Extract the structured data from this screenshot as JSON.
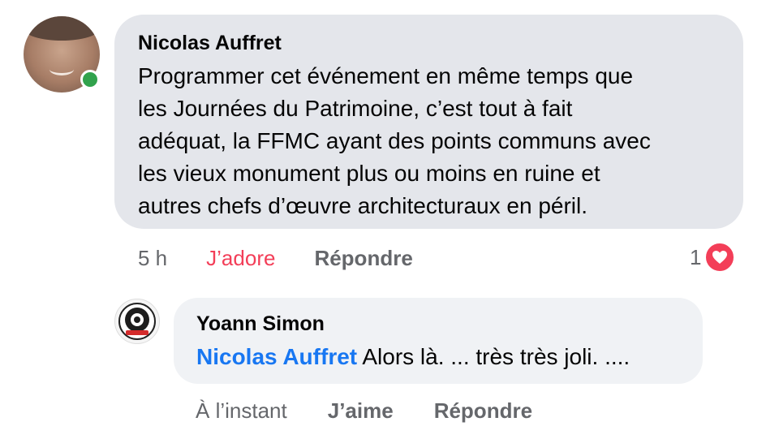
{
  "comment": {
    "author": "Nicolas Auffret",
    "text": "Programmer cet événement en même temps que\nles Journées du Patrimoine, c’est tout à fait\nadéquat, la FFMC ayant des points communs avec\nles vieux monument plus ou moins en ruine et\nautres chefs d’œuvre architecturaux en péril.",
    "online": true,
    "time": "5 h",
    "like_label": "J’adore",
    "reply_label": "Répondre",
    "reaction_count": "1",
    "reaction_icon": "heart-icon"
  },
  "reply": {
    "author": "Yoann Simon",
    "mention": "Nicolas Auffret",
    "text": " Alors là. ... très très joli. ....",
    "time": "À l’instant",
    "like_label": "J’aime",
    "reply_label": "Répondre"
  },
  "colors": {
    "bubble_main": "#e4e6eb",
    "bubble_reply": "#f0f2f5",
    "love": "#f33e58",
    "mention": "#1877f2",
    "online": "#31a24c",
    "muted": "#65676b"
  }
}
